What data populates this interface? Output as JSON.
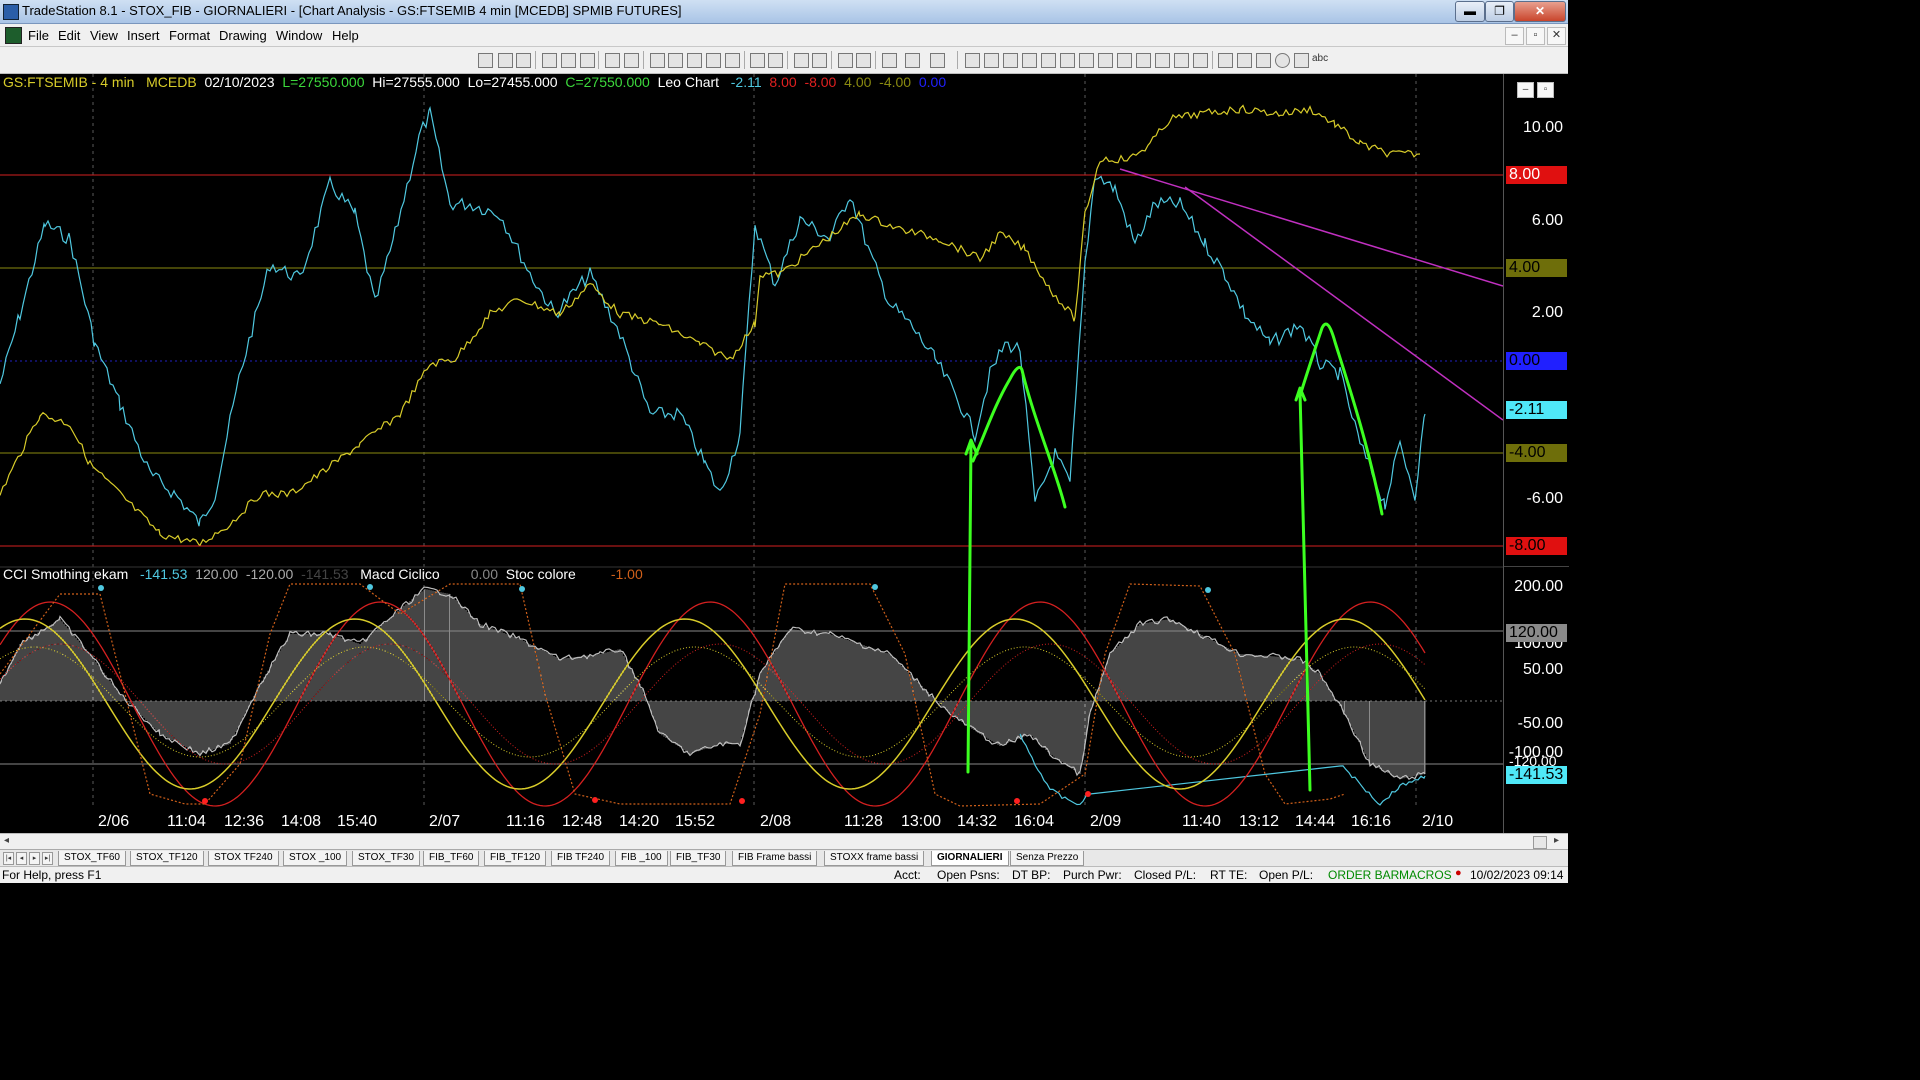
{
  "window": {
    "title": "TradeStation 8.1 - STOX_FIB - GIORNALIERI - [Chart Analysis - GS:FTSEMIB  4 min  [MCEDB] SPMIB FUTURES]"
  },
  "window_buttons": {
    "minimize": "▬",
    "restore": "❐",
    "close": "✕"
  },
  "menu": {
    "file": "File",
    "edit": "Edit",
    "view": "View",
    "insert": "Insert",
    "format": "Format",
    "drawing": "Drawing",
    "window": "Window",
    "help": "Help"
  },
  "mdi_controls": {
    "minimize": "–",
    "restore": "▫",
    "close": "✕"
  },
  "toolbar": {
    "text_tool": "abc"
  },
  "chart_header": {
    "symbol": "GS:FTSEMIB - 4 min",
    "exchange": "MCEDB",
    "date": "02/10/2023",
    "low": "L=27550.000",
    "high": "Hi=27555.000",
    "lo": "Lo=27455.000",
    "close": "C=27550.000",
    "study": "Leo Chart",
    "v1": "-2.11",
    "v2": "8.00",
    "v3": "-8.00",
    "v4": "4.00",
    "v5": "-4.00",
    "v6": "0.00"
  },
  "sub_header": {
    "study1": "CCI Smothing ekam",
    "s1v1": "-141.53",
    "s1v2": "120.00",
    "s1v3": "-120.00",
    "s1v4": "-141.53",
    "study2": "Macd Ciclico",
    "s2v1": "0.00",
    "study3": "Stoc colore",
    "s3v1": "-1.00"
  },
  "price_axis": {
    "labels": [
      "10.00",
      "6.00",
      "2.00",
      "-6.00"
    ],
    "tags": {
      "t8": "8.00",
      "t4": "4.00",
      "t0": "0.00",
      "tcur": "-2.11",
      "tm4": "-4.00",
      "tm8": "-8.00"
    }
  },
  "sub_axis": {
    "labels": [
      "200.00",
      "100.00",
      "50.00",
      "-50.00",
      "-100.00"
    ],
    "tags": {
      "t120": "120.00",
      "tcur": "-141.53",
      "tm120": "-120.00"
    }
  },
  "time_axis": [
    "2/06",
    "11:04",
    "12:36",
    "14:08",
    "15:40",
    "2/07",
    "11:16",
    "12:48",
    "14:20",
    "15:52",
    "2/08",
    "11:28",
    "13:00",
    "14:32",
    "16:04",
    "2/09",
    "11:40",
    "13:12",
    "14:44",
    "16:16",
    "2/10"
  ],
  "sheet_tabs": [
    "STOX_TF60",
    "STOX_TF120",
    "STOX TF240",
    "STOX _100",
    "STOX_TF30",
    "FIB_TF60",
    "FIB_TF120",
    "FIB TF240",
    "FIB _100",
    "FIB_TF30",
    "FIB Frame bassi",
    "STOXX frame bassi",
    "GIORNALIERI",
    "Senza Prezzo"
  ],
  "active_tab": "GIORNALIERI",
  "status": {
    "help": "For Help, press F1",
    "acct": "Acct:",
    "open_psns": "Open Psns:",
    "dt_bp": "DT BP:",
    "purch_pwr": "Purch Pwr:",
    "closed_pl": "Closed P/L:",
    "rt_te": "RT TE:",
    "open_pl": "Open P/L:",
    "order_bar": "ORDER BAR",
    "macros": "MACROS",
    "datetime": "10/02/2023 09:14"
  },
  "colors": {
    "cyan": "#4fc8e0",
    "yellow": "#d8cc2a",
    "red": "#d42020",
    "green": "#3cff20",
    "magenta": "#c030c0",
    "olive": "#8a8a10",
    "blue": "#2020ff"
  }
}
